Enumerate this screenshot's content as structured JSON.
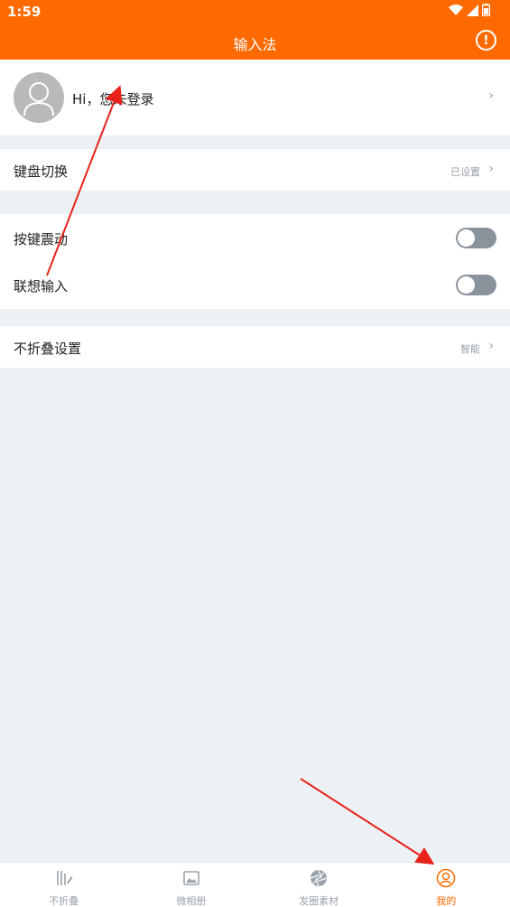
{
  "status_bar": {
    "time": "1:59"
  },
  "header": {
    "title": "输入法",
    "info_icon": "info-icon"
  },
  "profile": {
    "greeting": "Hi，您未登录",
    "avatar_icon": "user-avatar-icon"
  },
  "keyboard_switch": {
    "label": "键盘切换",
    "value": "已设置"
  },
  "toggles": [
    {
      "label": "按键震动",
      "on": false
    },
    {
      "label": "联想输入",
      "on": false
    }
  ],
  "fold_settings": {
    "label": "不折叠设置",
    "value": "智能"
  },
  "tabbar": [
    {
      "label": "不折叠",
      "icon": "text-edit-icon",
      "active": false
    },
    {
      "label": "微相册",
      "icon": "image-icon",
      "active": false
    },
    {
      "label": "发圈素材",
      "icon": "aperture-icon",
      "active": false
    },
    {
      "label": "我的",
      "icon": "user-circle-icon",
      "active": true
    }
  ],
  "colors": {
    "accent": "#ff6a00",
    "background": "#ecf1f5",
    "annotation_arrow": "#e8231b"
  }
}
